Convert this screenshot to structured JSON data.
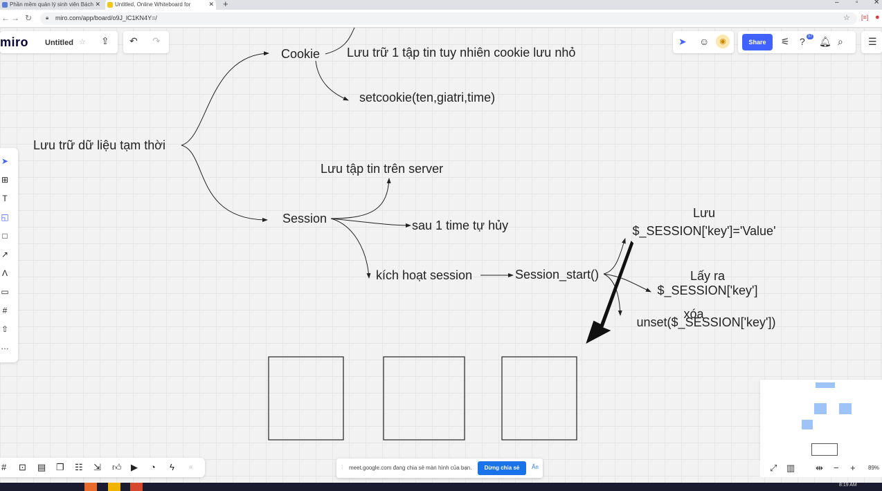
{
  "browser": {
    "tabs": [
      {
        "label": "Phần mềm quản lý sinh viên Bách",
        "active": false
      },
      {
        "label": "Untitled, Online Whiteboard for",
        "active": true
      }
    ],
    "url": "miro.com/app/board/o9J_lC1KN4Y=/"
  },
  "miro": {
    "logo": "miro",
    "board_title": "Untitled",
    "share_label": "Share",
    "notification_count": "37",
    "zoom": "89%"
  },
  "mindmap": {
    "root": "Lưu trữ dữ liệu tạm thời",
    "cookie": "Cookie",
    "cookie_desc": "Lưu trữ 1 tập tin tuy nhiên cookie lưu nhỏ",
    "setcookie": "setcookie(ten,giatri,time)",
    "session": "Session",
    "session_store": "Lưu tập tin trên server",
    "session_expire": "sau 1 time tự hủy",
    "session_activate": "kích hoạt session",
    "session_start": "Session_start()",
    "save_title": "Lưu",
    "save_code": "$_SESSION['key']='Value'",
    "get_title": "Lấy ra",
    "get_code": "$_SESSION['key']",
    "delete_title": "xóa",
    "delete_code": "unset($_SESSION['key'])"
  },
  "meet_bar": {
    "message": "meet.google.com đang chia sẻ màn hình của bạn.",
    "stop_label": "Dừng chia sẻ",
    "hide_label": "Ẩn"
  },
  "taskbar": {
    "time": "8:19 AM"
  },
  "colors": {
    "share_button": "#4262ff",
    "meet_button": "#1a73e8",
    "minimap_block": "#9ec3f7"
  }
}
